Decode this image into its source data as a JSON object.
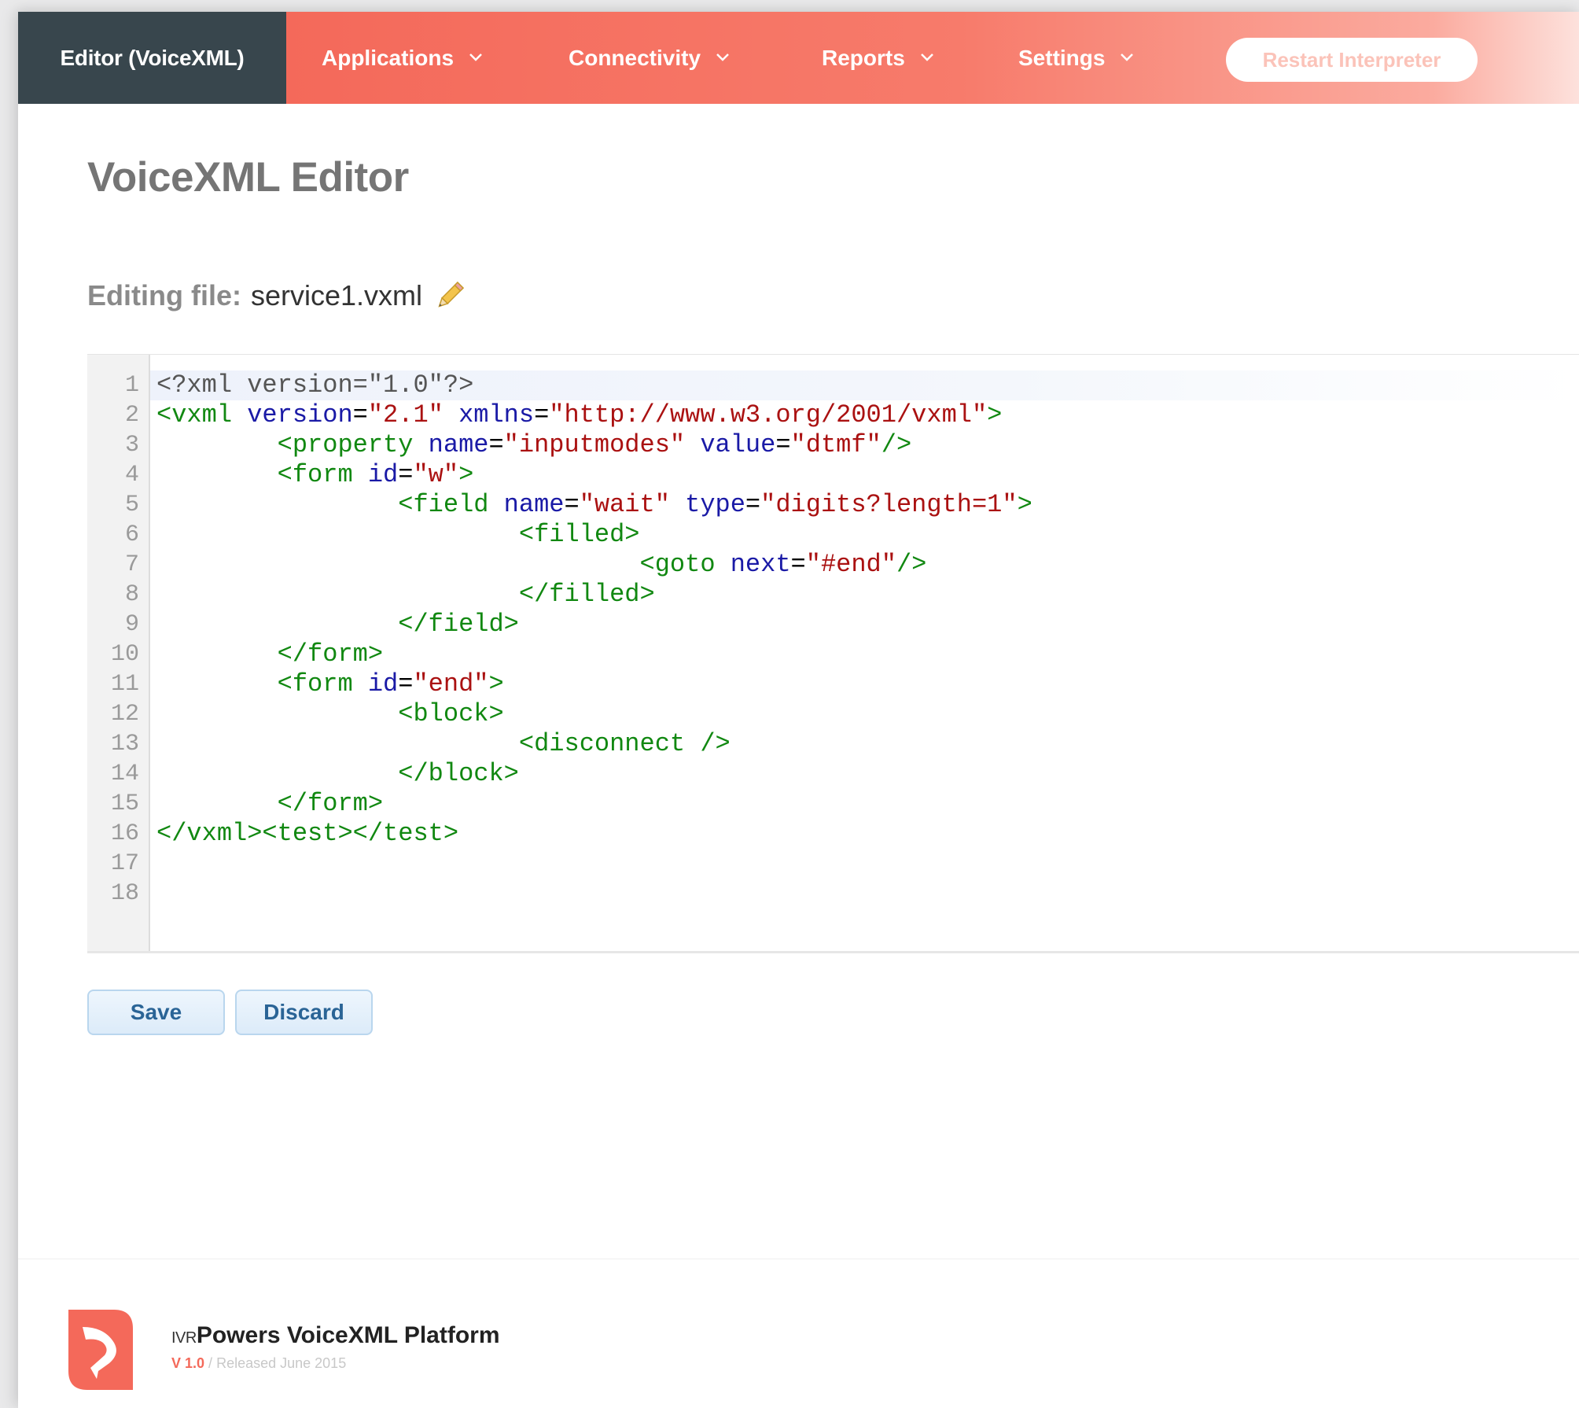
{
  "nav": {
    "brand": "Editor (VoiceXML)",
    "items": [
      {
        "label": "Applications"
      },
      {
        "label": "Connectivity"
      },
      {
        "label": "Reports"
      },
      {
        "label": "Settings"
      }
    ],
    "restart_label": "Restart Interpreter",
    "colors": {
      "brand_bg": "#38464d",
      "accent": "#f4695a"
    }
  },
  "main": {
    "title": "VoiceXML Editor",
    "editing_label": "Editing file:",
    "file_name": "service1.vxml",
    "edit_icon": "pencil-icon"
  },
  "editor": {
    "line_numbers": [
      "1",
      "2",
      "3",
      "4",
      "5",
      "6",
      "7",
      "8",
      "9",
      "10",
      "11",
      "12",
      "13",
      "14",
      "15",
      "16",
      "17",
      "18"
    ],
    "lines": [
      "<?xml version=\"1.0\"?>",
      "<vxml version=\"2.1\" xmlns=\"http://www.w3.org/2001/vxml\">",
      "        <property name=\"inputmodes\" value=\"dtmf\"/>",
      "        <form id=\"w\">",
      "                <field name=\"wait\" type=\"digits?length=1\">",
      "                        <filled>",
      "                                <goto next=\"#end\"/>",
      "                        </filled>",
      "                </field>",
      "        </form>",
      "        <form id=\"end\">",
      "                <block>",
      "                        <disconnect />",
      "                </block>",
      "        </form>",
      "</vxml><test></test>",
      "",
      ""
    ],
    "active_line": 1
  },
  "actions": {
    "save_label": "Save",
    "discard_label": "Discard"
  },
  "footer": {
    "brand_prefix": "IVR",
    "brand_name": "Powers VoiceXML Platform",
    "version": "V 1.0",
    "separator": "/",
    "released": "Released June 2015",
    "logo_icon": "ivrpowers-logo-icon"
  }
}
